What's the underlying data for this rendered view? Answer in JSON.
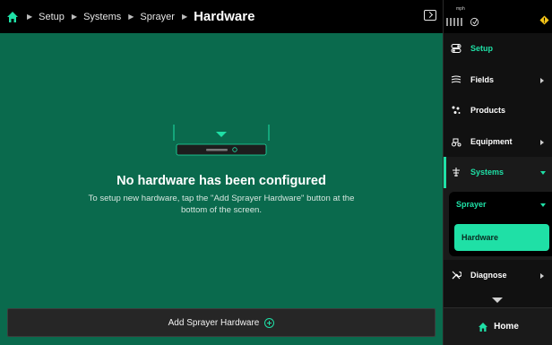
{
  "header": {
    "breadcrumbs": [
      "Setup",
      "Systems",
      "Sprayer"
    ],
    "title": "Hardware"
  },
  "main": {
    "empty_title": "No hardware has been configured",
    "empty_description": "To setup new hardware, tap the \"Add Sprayer Hardware\" button at the bottom of the screen.",
    "add_button_label": "Add Sprayer Hardware"
  },
  "status": {
    "speed_unit": "mph"
  },
  "sidebar": {
    "items": [
      {
        "label": "Setup",
        "icon": "toggles-icon",
        "has_arrow": false,
        "active": true
      },
      {
        "label": "Fields",
        "icon": "field-icon",
        "has_arrow": true
      },
      {
        "label": "Products",
        "icon": "seeds-icon",
        "has_arrow": false
      },
      {
        "label": "Equipment",
        "icon": "tractor-icon",
        "has_arrow": true
      }
    ],
    "systems_label": "Systems",
    "submenu": {
      "heading": "Sprayer",
      "item": "Hardware"
    },
    "diagnose_label": "Diagnose",
    "home_label": "Home"
  },
  "colors": {
    "accent": "#1fe0a6",
    "main_bg": "#0a6a4d",
    "header_bg": "#000000",
    "sidebar_bg": "#111111",
    "warning": "#f5c518"
  }
}
